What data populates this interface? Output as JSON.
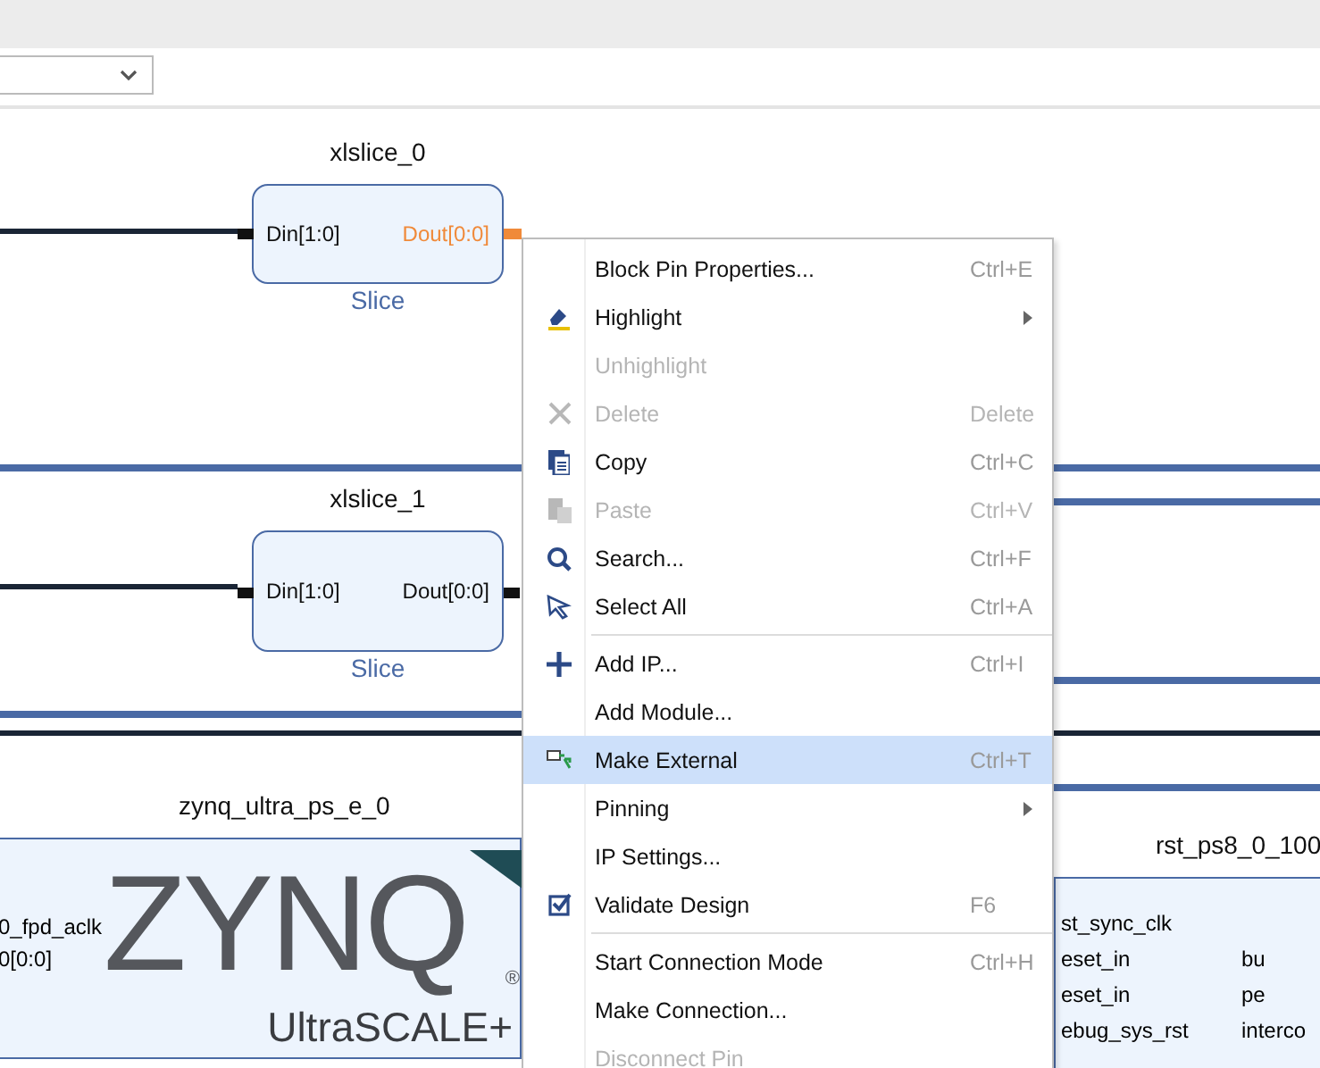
{
  "diagram": {
    "blocks": [
      {
        "kind": "slice",
        "title": "xlslice_0",
        "subtitle": "Slice",
        "pin_in": "Din[1:0]",
        "pin_out": {
          "label": "Dout[0:0]",
          "selected": true
        }
      },
      {
        "kind": "slice",
        "title": "xlslice_1",
        "subtitle": "Slice",
        "pin_in": "Din[1:0]",
        "pin_out": {
          "label": "Dout[0:0]",
          "selected": false
        }
      },
      {
        "kind": "zynq",
        "title": "zynq_ultra_ps_e_0",
        "pins_left": [
          "0_fpd_aclk",
          "0[0:0]"
        ],
        "logo_main": "ZYNQ",
        "logo_mark": "®",
        "logo_sub": "UltraSCALE+"
      },
      {
        "kind": "reset",
        "title": "rst_ps8_0_100",
        "rows": [
          {
            "left": "st_sync_clk"
          },
          {
            "left": "eset_in",
            "right": "bu"
          },
          {
            "left": "eset_in",
            "right": "pe"
          },
          {
            "left": "ebug_sys_rst",
            "right": "interco"
          }
        ]
      }
    ]
  },
  "context_menu": {
    "sections": [
      [
        {
          "label": "Block Pin Properties...",
          "shortcut": "Ctrl+E",
          "disabled": false,
          "submenu": false,
          "selected": false
        },
        {
          "label": "Highlight",
          "disabled": false,
          "submenu": true,
          "selected": false
        },
        {
          "label": "Unhighlight",
          "disabled": true,
          "submenu": false,
          "selected": false
        },
        {
          "label": "Delete",
          "shortcut": "Delete",
          "disabled": true,
          "submenu": false,
          "selected": false
        },
        {
          "label": "Copy",
          "shortcut": "Ctrl+C",
          "disabled": false,
          "submenu": false,
          "selected": false
        },
        {
          "label": "Paste",
          "shortcut": "Ctrl+V",
          "disabled": true,
          "submenu": false,
          "selected": false
        },
        {
          "label": "Search...",
          "shortcut": "Ctrl+F",
          "disabled": false,
          "submenu": false,
          "selected": false
        },
        {
          "label": "Select All",
          "shortcut": "Ctrl+A",
          "disabled": false,
          "submenu": false,
          "selected": false
        }
      ],
      [
        {
          "label": "Add IP...",
          "shortcut": "Ctrl+I",
          "disabled": false,
          "submenu": false,
          "selected": false
        },
        {
          "label": "Add Module...",
          "disabled": false,
          "submenu": false,
          "selected": false
        },
        {
          "label": "Make External",
          "shortcut": "Ctrl+T",
          "disabled": false,
          "submenu": false,
          "selected": true
        },
        {
          "label": "Pinning",
          "disabled": false,
          "submenu": true,
          "selected": false
        },
        {
          "label": "IP Settings...",
          "disabled": false,
          "submenu": false,
          "selected": false
        },
        {
          "label": "Validate Design",
          "shortcut": "F6",
          "disabled": false,
          "submenu": false,
          "selected": false
        }
      ],
      [
        {
          "label": "Start Connection Mode",
          "shortcut": "Ctrl+H",
          "disabled": false,
          "submenu": false,
          "selected": false
        },
        {
          "label": "Make Connection...",
          "disabled": false,
          "submenu": false,
          "selected": false
        },
        {
          "label": "Disconnect Pin",
          "disabled": true,
          "submenu": false,
          "selected": false
        }
      ]
    ]
  }
}
